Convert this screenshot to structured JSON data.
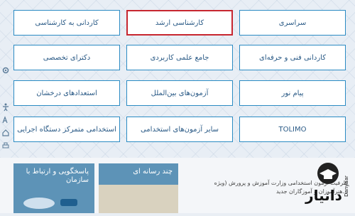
{
  "tiles": {
    "r1c1": "کاردانی به کارشناسی",
    "r1c2": "کارشناسی ارشد",
    "r1c3": "سراسری",
    "r2c1": "دکترای تخصصی",
    "r2c2": "جامع علمی کاربردی",
    "r2c3": "کاردانی فنی و حرفه‌ای",
    "r3c1": "استعدادهای درخشان",
    "r3c2": "آزمون‌های بین‌الملل",
    "r3c3": "پیام نور",
    "r4c1": "استخدامی متمرکز دستگاه اجرایی",
    "r4c2": "سایر آزمون‌های استخدامی",
    "r4c3": "TOLIMO"
  },
  "cards": {
    "support_title_line1": "پاسخگویی و ارتباط با",
    "support_title_line2": "سازمان",
    "media_title": "چند رسانه ای"
  },
  "news": {
    "line1": "ظرفیت آزمون استخدامی وزارت آموزش و پرورش (ویژه",
    "line2": "...هنرآموزان و آموزگاران جدید"
  },
  "logo": {
    "text": "دانیار",
    "subtext": "Danyaar"
  },
  "colors": {
    "tile_border": "#2b8bc3",
    "active_border": "#c7262f",
    "tile_text": "#2a5a86",
    "card_header": "#5d93b7"
  }
}
